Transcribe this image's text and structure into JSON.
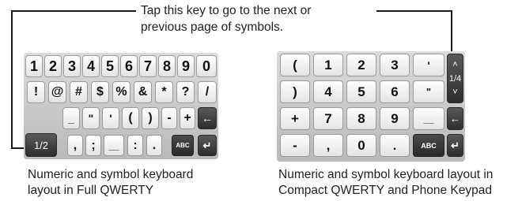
{
  "callout": {
    "line1": "Tap this key to go to the next or",
    "line2": "previous page of symbols."
  },
  "left_keyboard": {
    "row1": [
      "1",
      "2",
      "3",
      "4",
      "5",
      "6",
      "7",
      "8",
      "9",
      "0"
    ],
    "row2": [
      "!",
      "@",
      "#",
      "$",
      "%",
      "&",
      "*",
      "?",
      "/"
    ],
    "row3": [
      "_",
      "\"",
      "'",
      "(",
      ")",
      "-",
      "+"
    ],
    "row4": [
      "1/2",
      ",",
      ";",
      "__",
      ":",
      "."
    ],
    "abc_label": "ABC",
    "backspace_glyph": "←",
    "enter_glyph": "↵"
  },
  "right_keyboard": {
    "rows": [
      [
        "(",
        "1",
        "2",
        "3",
        "'"
      ],
      [
        ")",
        "4",
        "5",
        "6",
        "\""
      ],
      [
        "+",
        "7",
        "8",
        "9",
        "__"
      ],
      [
        "-",
        ",",
        "0",
        "."
      ]
    ],
    "page_label": "1/4",
    "up_glyph": "˄",
    "down_glyph": "˅",
    "abc_label": "ABC",
    "backspace_glyph": "←",
    "enter_glyph": "↵"
  },
  "captions": {
    "left_line1": "Numeric and symbol keyboard",
    "left_line2": "layout in Full QWERTY",
    "right_line1": "Numeric and symbol keyboard layout in",
    "right_line2": "Compact QWERTY and Phone Keypad"
  }
}
